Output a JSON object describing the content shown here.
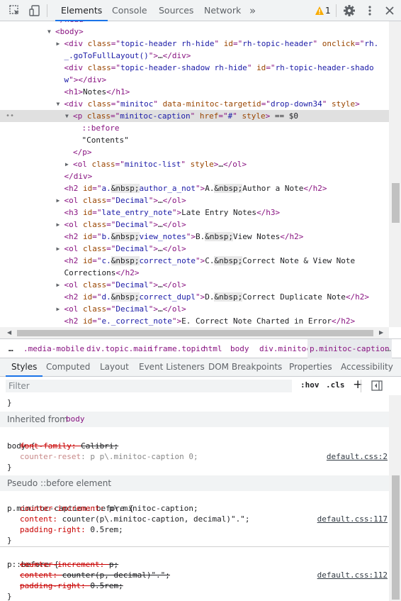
{
  "toolbar": {
    "tabs": [
      "Elements",
      "Console",
      "Sources",
      "Network"
    ],
    "more": "»",
    "warning_count": "1"
  },
  "dom": {
    "lines": [
      {
        "indent": 6,
        "tri": "",
        "parts": [
          [
            "tag",
            "</head>"
          ]
        ]
      },
      {
        "indent": 6,
        "tri": "open",
        "parts": [
          [
            "tag",
            "<body>"
          ]
        ]
      },
      {
        "indent": 7,
        "tri": "closed",
        "parts": [
          [
            "tag",
            "<div "
          ],
          [
            "an",
            "class"
          ],
          [
            "tag",
            "=\""
          ],
          [
            "av",
            "topic-header rh-hide"
          ],
          [
            "tag",
            "\" "
          ],
          [
            "an",
            "id"
          ],
          [
            "tag",
            "=\""
          ],
          [
            "av",
            "rh-topic-header"
          ],
          [
            "tag",
            "\" "
          ],
          [
            "an",
            "onclick"
          ],
          [
            "tag",
            "=\""
          ],
          [
            "av",
            "rh."
          ]
        ]
      },
      {
        "indent": 7,
        "tri": "",
        "parts": [
          [
            "av",
            "_.goToFullLayout()"
          ],
          [
            "tag",
            "\">"
          ],
          [
            "txt",
            "…"
          ],
          [
            "tag",
            "</div>"
          ]
        ]
      },
      {
        "indent": 7,
        "tri": "",
        "parts": [
          [
            "tag",
            "<div "
          ],
          [
            "an",
            "class"
          ],
          [
            "tag",
            "=\""
          ],
          [
            "av",
            "topic-header-shadow rh-hide"
          ],
          [
            "tag",
            "\" "
          ],
          [
            "an",
            "id"
          ],
          [
            "tag",
            "=\""
          ],
          [
            "av",
            "rh-topic-header-shado"
          ]
        ]
      },
      {
        "indent": 7,
        "tri": "",
        "parts": [
          [
            "av",
            "w"
          ],
          [
            "tag",
            "\"></div>"
          ]
        ]
      },
      {
        "indent": 7,
        "tri": "",
        "parts": [
          [
            "tag",
            "<h1>"
          ],
          [
            "txt",
            "Notes"
          ],
          [
            "tag",
            "</h1>"
          ]
        ]
      },
      {
        "indent": 7,
        "tri": "open",
        "parts": [
          [
            "tag",
            "<div "
          ],
          [
            "an",
            "class"
          ],
          [
            "tag",
            "=\""
          ],
          [
            "av",
            "minitoc"
          ],
          [
            "tag",
            "\" "
          ],
          [
            "an",
            "data-minitoc-targetid"
          ],
          [
            "tag",
            "=\""
          ],
          [
            "av",
            "drop-down34"
          ],
          [
            "tag",
            "\" "
          ],
          [
            "an",
            "style"
          ],
          [
            "tag",
            ">"
          ]
        ]
      },
      {
        "indent": 8,
        "tri": "open",
        "sel": true,
        "parts": [
          [
            "tag",
            "<p "
          ],
          [
            "an",
            "class"
          ],
          [
            "tag",
            "=\""
          ],
          [
            "av",
            "minitoc-caption"
          ],
          [
            "tag",
            "\" "
          ],
          [
            "an",
            "href"
          ],
          [
            "tag",
            "=\""
          ],
          [
            "av",
            "#"
          ],
          [
            "tag",
            "\" "
          ],
          [
            "an",
            "style"
          ],
          [
            "tag",
            "> "
          ],
          [
            "txt",
            "== $0"
          ]
        ]
      },
      {
        "indent": 9,
        "tri": "",
        "parts": [
          [
            "tag",
            "::before"
          ]
        ]
      },
      {
        "indent": 9,
        "tri": "",
        "parts": [
          [
            "txt",
            "\"Contents\""
          ]
        ]
      },
      {
        "indent": 8,
        "tri": "",
        "parts": [
          [
            "tag",
            "</p>"
          ]
        ]
      },
      {
        "indent": 8,
        "tri": "closed",
        "parts": [
          [
            "tag",
            "<ol "
          ],
          [
            "an",
            "class"
          ],
          [
            "tag",
            "=\""
          ],
          [
            "av",
            "minitoc-list"
          ],
          [
            "tag",
            "\" "
          ],
          [
            "an",
            "style"
          ],
          [
            "tag",
            ">"
          ],
          [
            "txt",
            "…"
          ],
          [
            "tag",
            "</ol>"
          ]
        ]
      },
      {
        "indent": 7,
        "tri": "",
        "parts": [
          [
            "tag",
            "</div>"
          ]
        ]
      },
      {
        "indent": 7,
        "tri": "",
        "parts": [
          [
            "tag",
            "<h2 "
          ],
          [
            "an",
            "id"
          ],
          [
            "tag",
            "=\""
          ],
          [
            "av",
            "a."
          ],
          [
            "ent",
            "&nbsp;"
          ],
          [
            "av",
            "author_a_not"
          ],
          [
            "tag",
            "\">"
          ],
          [
            "txt",
            "A."
          ],
          [
            "ent",
            "&nbsp;"
          ],
          [
            "txt",
            "Author a Note"
          ],
          [
            "tag",
            "</h2>"
          ]
        ]
      },
      {
        "indent": 7,
        "tri": "closed",
        "parts": [
          [
            "tag",
            "<ol "
          ],
          [
            "an",
            "class"
          ],
          [
            "tag",
            "=\""
          ],
          [
            "av",
            "Decimal"
          ],
          [
            "tag",
            "\">"
          ],
          [
            "txt",
            "…"
          ],
          [
            "tag",
            "</ol>"
          ]
        ]
      },
      {
        "indent": 7,
        "tri": "",
        "parts": [
          [
            "tag",
            "<h3 "
          ],
          [
            "an",
            "id"
          ],
          [
            "tag",
            "=\""
          ],
          [
            "av",
            "late_entry_note"
          ],
          [
            "tag",
            "\">"
          ],
          [
            "txt",
            "Late Entry Notes"
          ],
          [
            "tag",
            "</h3>"
          ]
        ]
      },
      {
        "indent": 7,
        "tri": "closed",
        "parts": [
          [
            "tag",
            "<ol "
          ],
          [
            "an",
            "class"
          ],
          [
            "tag",
            "=\""
          ],
          [
            "av",
            "Decimal"
          ],
          [
            "tag",
            "\">"
          ],
          [
            "txt",
            "…"
          ],
          [
            "tag",
            "</ol>"
          ]
        ]
      },
      {
        "indent": 7,
        "tri": "",
        "parts": [
          [
            "tag",
            "<h2 "
          ],
          [
            "an",
            "id"
          ],
          [
            "tag",
            "=\""
          ],
          [
            "av",
            "b."
          ],
          [
            "ent",
            "&nbsp;"
          ],
          [
            "av",
            "view_notes"
          ],
          [
            "tag",
            "\">"
          ],
          [
            "txt",
            "B."
          ],
          [
            "ent",
            "&nbsp;"
          ],
          [
            "txt",
            "View Notes"
          ],
          [
            "tag",
            "</h2>"
          ]
        ]
      },
      {
        "indent": 7,
        "tri": "closed",
        "parts": [
          [
            "tag",
            "<ol "
          ],
          [
            "an",
            "class"
          ],
          [
            "tag",
            "=\""
          ],
          [
            "av",
            "Decimal"
          ],
          [
            "tag",
            "\">"
          ],
          [
            "txt",
            "…"
          ],
          [
            "tag",
            "</ol>"
          ]
        ]
      },
      {
        "indent": 7,
        "tri": "",
        "parts": [
          [
            "tag",
            "<h2 "
          ],
          [
            "an",
            "id"
          ],
          [
            "tag",
            "=\""
          ],
          [
            "av",
            "c."
          ],
          [
            "ent",
            "&nbsp;"
          ],
          [
            "av",
            "correct_note"
          ],
          [
            "tag",
            "\">"
          ],
          [
            "txt",
            "C."
          ],
          [
            "ent",
            "&nbsp;"
          ],
          [
            "txt",
            "Correct Note & View Note"
          ]
        ]
      },
      {
        "indent": 7,
        "tri": "",
        "parts": [
          [
            "txt",
            "Corrections"
          ],
          [
            "tag",
            "</h2>"
          ]
        ]
      },
      {
        "indent": 7,
        "tri": "closed",
        "parts": [
          [
            "tag",
            "<ol "
          ],
          [
            "an",
            "class"
          ],
          [
            "tag",
            "=\""
          ],
          [
            "av",
            "Decimal"
          ],
          [
            "tag",
            "\">"
          ],
          [
            "txt",
            "…"
          ],
          [
            "tag",
            "</ol>"
          ]
        ]
      },
      {
        "indent": 7,
        "tri": "",
        "parts": [
          [
            "tag",
            "<h2 "
          ],
          [
            "an",
            "id"
          ],
          [
            "tag",
            "=\""
          ],
          [
            "av",
            "d."
          ],
          [
            "ent",
            "&nbsp;"
          ],
          [
            "av",
            "correct_dupl"
          ],
          [
            "tag",
            "\">"
          ],
          [
            "txt",
            "D."
          ],
          [
            "ent",
            "&nbsp;"
          ],
          [
            "txt",
            "Correct Duplicate Note"
          ],
          [
            "tag",
            "</h2>"
          ]
        ]
      },
      {
        "indent": 7,
        "tri": "closed",
        "parts": [
          [
            "tag",
            "<ol "
          ],
          [
            "an",
            "class"
          ],
          [
            "tag",
            "=\""
          ],
          [
            "av",
            "Decimal"
          ],
          [
            "tag",
            "\">"
          ],
          [
            "txt",
            "…"
          ],
          [
            "tag",
            "</ol>"
          ]
        ]
      },
      {
        "indent": 7,
        "tri": "",
        "parts": [
          [
            "tag",
            "<h2 "
          ],
          [
            "an",
            "id"
          ],
          [
            "tag",
            "=\""
          ],
          [
            "av",
            "e._correct_note"
          ],
          [
            "tag",
            "\">"
          ],
          [
            "txt",
            "E. Correct Note Charted in Error"
          ],
          [
            "tag",
            "</h2>"
          ]
        ]
      }
    ]
  },
  "breadcrumb": [
    "…",
    ".media-mobile",
    "div.topic.main",
    "iframe.topic",
    "html",
    "body",
    "div.minitoc",
    "p.minitoc-caption",
    "…"
  ],
  "subtabs": [
    "Styles",
    "Computed",
    "Layout",
    "Event Listeners",
    "DOM Breakpoints",
    "Properties",
    "Accessibility"
  ],
  "filter": {
    "placeholder": "Filter",
    "hov": ":hov",
    "cls": ".cls",
    "plus": "+"
  },
  "styles": {
    "close_brace_top": "}",
    "inherited_label": "Inherited from",
    "inherited_from": "body",
    "body_rule": {
      "selector": "body {",
      "source": "default.css:2",
      "props": [
        {
          "name": "font-family",
          "value": "Calibri;",
          "strike": true,
          "dim": false
        },
        {
          "name": "counter-reset",
          "value": "p p\\.minitoc-caption 0;",
          "strike": false,
          "dim": true
        }
      ],
      "close": "}"
    },
    "pseudo_label": "Pseudo ::before element",
    "caption_rule": {
      "selector": "p.minitoc-caption::before {",
      "source": "default.css:117",
      "props": [
        {
          "name": "counter-increment",
          "value": "p\\.minitoc-caption;",
          "strike": false,
          "dim": false
        },
        {
          "name": "content",
          "value": "counter(p\\.minitoc-caption, decimal)\".\";",
          "strike": false,
          "dim": false
        },
        {
          "name": "padding-right",
          "value": "0.5rem;",
          "strike": false,
          "dim": false
        }
      ],
      "close": "}"
    },
    "p_rule": {
      "selector": "p::before {",
      "source": "default.css:112",
      "props": [
        {
          "name": "counter-increment",
          "value": "p;",
          "strike": true,
          "dim": false
        },
        {
          "name": "content",
          "value": "counter(p, decimal)\".\";",
          "strike": true,
          "dim": false
        },
        {
          "name": "padding-right",
          "value": "0.5rem;",
          "strike": true,
          "dim": false
        }
      ],
      "close": "}"
    }
  }
}
